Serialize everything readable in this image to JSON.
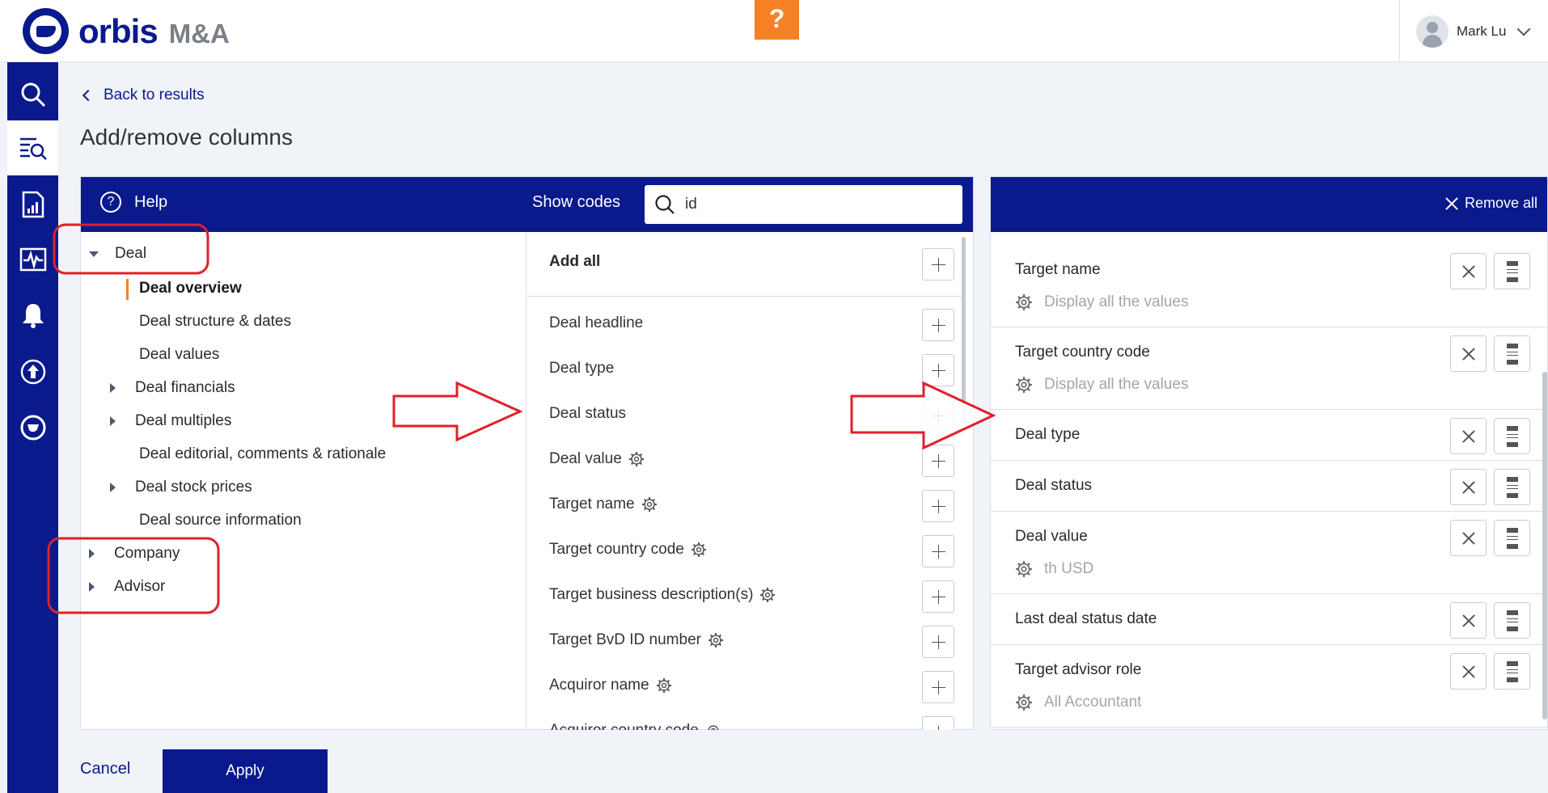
{
  "app": {
    "brand": "orbis",
    "product": "M&A",
    "help_glyph": "?"
  },
  "user": {
    "name": "Mark Lu"
  },
  "nav": {
    "back_label": "Back to results",
    "page_title": "Add/remove columns"
  },
  "sidebar": {
    "items": [
      {
        "icon": "search-icon",
        "active": false
      },
      {
        "icon": "list-search-icon",
        "active": true
      },
      {
        "icon": "report-chart-icon",
        "active": false
      },
      {
        "icon": "pulse-monitor-icon",
        "active": false
      },
      {
        "icon": "bell-icon",
        "active": false
      },
      {
        "icon": "upload-icon",
        "active": false
      },
      {
        "icon": "orbis-logo-icon",
        "active": false
      }
    ]
  },
  "left_panel": {
    "help_label": "Help",
    "help_glyph": "?",
    "show_codes_label": "Show codes",
    "search_value": "id",
    "tree": [
      {
        "label": "Deal",
        "expanded": true
      },
      {
        "label": "Deal overview",
        "selected": true
      },
      {
        "label": "Deal structure & dates"
      },
      {
        "label": "Deal values"
      },
      {
        "label": "Deal financials",
        "collapsed": true
      },
      {
        "label": "Deal multiples",
        "collapsed": true
      },
      {
        "label": "Deal editorial, comments & rationale"
      },
      {
        "label": "Deal stock prices",
        "collapsed": true
      },
      {
        "label": "Deal source information"
      },
      {
        "label": "Company",
        "collapsed": true
      },
      {
        "label": "Advisor",
        "collapsed": true
      }
    ],
    "add_all_label": "Add all",
    "fields": [
      {
        "label": "Deal headline",
        "has_settings": false
      },
      {
        "label": "Deal type",
        "has_settings": false
      },
      {
        "label": "Deal status",
        "has_settings": false
      },
      {
        "label": "Deal value",
        "has_settings": true
      },
      {
        "label": "Target name",
        "has_settings": true
      },
      {
        "label": "Target country code",
        "has_settings": true
      },
      {
        "label": "Target business description(s)",
        "has_settings": true
      },
      {
        "label": "Target BvD ID number",
        "has_settings": true
      },
      {
        "label": "Acquiror name",
        "has_settings": true
      },
      {
        "label": "Acquiror country code",
        "has_settings": true
      }
    ]
  },
  "right_panel": {
    "remove_all_label": "Remove all",
    "selected": [
      {
        "title": "Target name",
        "sub": "Display all the values"
      },
      {
        "title": "Target country code",
        "sub": "Display all the values"
      },
      {
        "title": "Deal type",
        "sub": ""
      },
      {
        "title": "Deal status",
        "sub": ""
      },
      {
        "title": "Deal value",
        "sub": "th USD"
      },
      {
        "title": "Last deal status date",
        "sub": ""
      },
      {
        "title": "Target advisor role",
        "sub": "All Accountant"
      }
    ]
  },
  "footer": {
    "cancel_label": "Cancel",
    "apply_label": "Apply"
  },
  "colors": {
    "brand_blue": "#0a1a8c",
    "accent_orange": "#f58025",
    "annotation_red": "#e0202a"
  }
}
